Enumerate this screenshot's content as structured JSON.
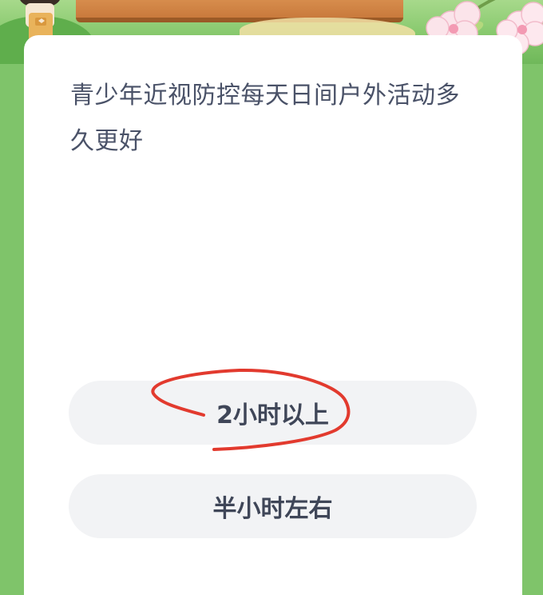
{
  "quiz": {
    "question": "青少年近视防控每天日间户外活动多久更好",
    "options": [
      {
        "label": "2小时以上",
        "annotated": true
      },
      {
        "label": "半小时左右",
        "annotated": false
      }
    ]
  },
  "colors": {
    "question_text": "#4a5268",
    "option_bg": "#f2f3f5",
    "annotation_stroke": "#e23a2e",
    "banner_green": "#86c86c"
  }
}
